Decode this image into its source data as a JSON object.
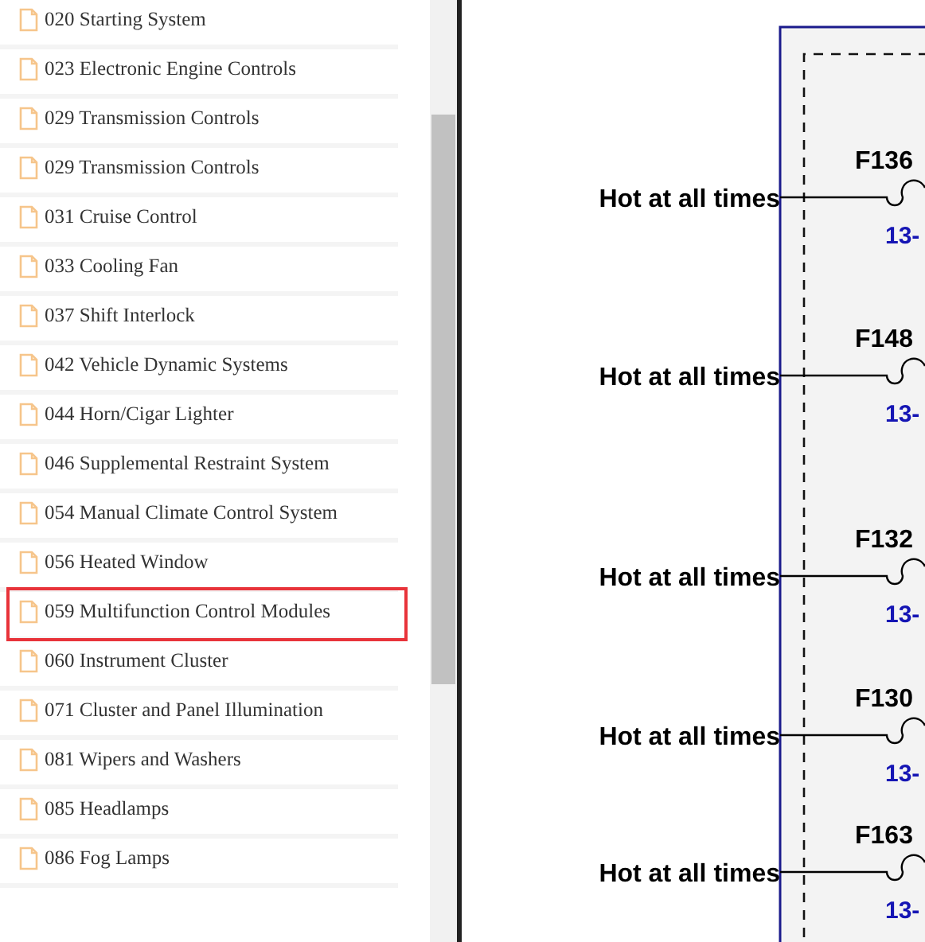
{
  "sidebar": {
    "items": [
      {
        "label": "020 Starting System",
        "selected": false
      },
      {
        "label": "023 Electronic Engine Controls",
        "selected": false
      },
      {
        "label": "029 Transmission Controls",
        "selected": false
      },
      {
        "label": "029 Transmission Controls",
        "selected": false
      },
      {
        "label": "031 Cruise Control",
        "selected": false
      },
      {
        "label": "033 Cooling Fan",
        "selected": false
      },
      {
        "label": "037 Shift Interlock",
        "selected": false
      },
      {
        "label": "042 Vehicle Dynamic Systems",
        "selected": false
      },
      {
        "label": "044 Horn/Cigar Lighter",
        "selected": false
      },
      {
        "label": "046 Supplemental Restraint System",
        "selected": false
      },
      {
        "label": "054 Manual Climate Control System",
        "selected": false
      },
      {
        "label": "056 Heated Window",
        "selected": false
      },
      {
        "label": "059 Multifunction Control Modules",
        "selected": true
      },
      {
        "label": "060 Instrument Cluster",
        "selected": false
      },
      {
        "label": "071 Cluster and Panel Illumination",
        "selected": false
      },
      {
        "label": "081 Wipers and Washers",
        "selected": false
      },
      {
        "label": "085 Headlamps",
        "selected": false
      },
      {
        "label": "086 Fog Lamps",
        "selected": false
      }
    ]
  },
  "diagram": {
    "circuits": [
      {
        "source": "Hot at all times",
        "fuse": "F136",
        "ref": "13-"
      },
      {
        "source": "Hot at all times",
        "fuse": "F148",
        "ref": "13-"
      },
      {
        "source": "Hot at all times",
        "fuse": "F132",
        "ref": "13-"
      },
      {
        "source": "Hot at all times",
        "fuse": "F130",
        "ref": "13-"
      },
      {
        "source": "Hot at all times",
        "fuse": "F163",
        "ref": "13-"
      }
    ]
  }
}
